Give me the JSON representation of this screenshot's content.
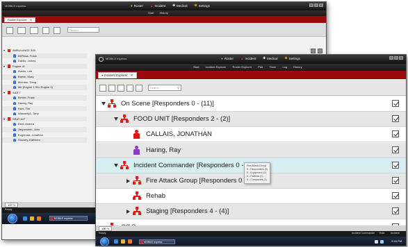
{
  "back_window": {
    "app_title": "MOBILE express",
    "nav": [
      "Roster",
      "Incident",
      "Medical",
      "Settings"
    ],
    "subnav": [
      "Start",
      "History"
    ],
    "tab_label": "Roster Explorer",
    "search_placeholder": "Search",
    "rows": [
      {
        "text": "AMBULANCE 345",
        "type": "group"
      },
      {
        "text": "DeRosa, Frank",
        "type": "person"
      },
      {
        "text": "Darilio, James",
        "type": "person"
      },
      {
        "text": "Engine 41",
        "type": "group"
      },
      {
        "text": "Austin, Lee",
        "type": "person"
      },
      {
        "text": "Barish, Mary",
        "type": "person"
      },
      {
        "text": "McIntire, Doug",
        "type": "person"
      },
      {
        "text": "Mir [Engine 1 Sim Engine 1]",
        "type": "person"
      },
      {
        "text": "SAR 7",
        "type": "group"
      },
      {
        "text": "Bende, Frank",
        "type": "person"
      },
      {
        "text": "Haring, Ray",
        "type": "person"
      },
      {
        "text": "Hunt, Tim",
        "type": "person"
      },
      {
        "text": "Wasserig1, Terry",
        "type": "person"
      },
      {
        "text": "SRAT 407",
        "type": "group"
      },
      {
        "text": "Dole, Andrea",
        "type": "person"
      },
      {
        "text": "Jasperstein, John",
        "type": "person"
      },
      {
        "text": "Kugeman, Jonathan",
        "type": "person"
      },
      {
        "text": "Stuckey, Kathleen",
        "type": "person"
      }
    ],
    "zoom": "100 %",
    "status_left": "Ready",
    "taskbar_item": "MOBILE express"
  },
  "front_window": {
    "app_title": "MOBILE express",
    "nav": [
      "Roster",
      "Incident",
      "Medical",
      "Settings"
    ],
    "subnav": [
      "Start",
      "Incident Explorer",
      "Roster Explorer",
      "Pair",
      "Timer",
      "Log",
      "History"
    ],
    "tab_label": "Incident Explorer",
    "search_placeholder": "Search",
    "tree": [
      {
        "label": "On Scene [Responders 0 - (11)]",
        "kind": "group",
        "indent": 0,
        "expander": "down",
        "bg": "white"
      },
      {
        "label": "FOOD UNIT [Responders 2 - (2)]",
        "kind": "group",
        "indent": 1,
        "expander": "down",
        "bg": "grey"
      },
      {
        "label": "CALLAIS, JONATHAN",
        "kind": "person",
        "person_color": "#e01515",
        "indent": 2,
        "expander": "",
        "bg": "white"
      },
      {
        "label": "Haring, Ray",
        "kind": "person",
        "person_color": "#8a3bc4",
        "indent": 2,
        "expander": "",
        "bg": "grey"
      },
      {
        "label": "Incident Commander [Responders 0 - (9)]",
        "kind": "group",
        "indent": 1,
        "expander": "down",
        "bg": "hl"
      },
      {
        "label": "Fire Attack Group [Responders 0 - (5)]",
        "kind": "group",
        "indent": 2,
        "expander": "right",
        "bg": "grey"
      },
      {
        "label": "Rehab",
        "kind": "group",
        "indent": 2,
        "expander": "",
        "bg": "white"
      },
      {
        "label": "Staging [Responders 4 - (4)]",
        "kind": "group",
        "indent": 2,
        "expander": "right",
        "bg": "grey"
      },
      {
        "label": "Off Scene",
        "kind": "group",
        "indent": 0,
        "expander": "",
        "bg": "white"
      }
    ],
    "tooltip": [
      "Fire Attack Group",
      "0 - Responders (5)",
      "0 - Equipment (0)",
      "0 - Patients (0)",
      "0 - Companies (1)"
    ],
    "zoom": "100 %",
    "status_left": "Ready",
    "status_right": [
      "Incident Commander",
      "Rain",
      "Incident"
    ],
    "taskbar_item": "MOBILE express",
    "clock": "3:16 PM"
  },
  "colors": {
    "accent_red": "#9b0a0a",
    "group_icon": "#e81c14",
    "highlight_row": "#d7eef3"
  }
}
